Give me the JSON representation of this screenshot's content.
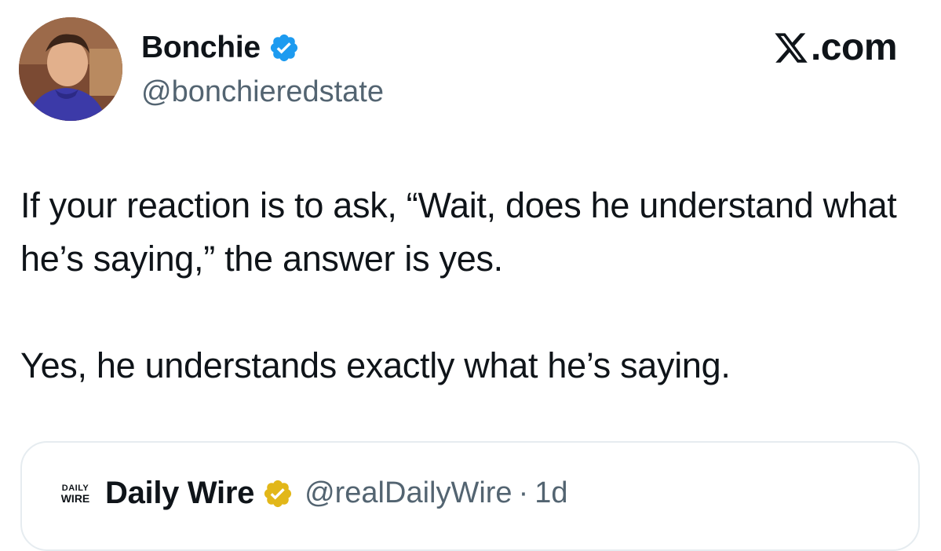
{
  "author": {
    "name": "Bonchie",
    "handle": "@bonchieredstate"
  },
  "site": {
    "label": ".com",
    "logo_icon": "x-logo-icon"
  },
  "tweet": {
    "paragraph1": "If your reaction is to ask, “Wait, does he understand what he’s saying,” the answer is yes.",
    "paragraph2": "Yes, he understands exactly what he’s saying."
  },
  "quote": {
    "logo_text_top": "DAILY",
    "logo_text_bottom": "WIRE",
    "name": "Daily Wire",
    "handle": "@realDailyWire",
    "separator": "·",
    "time": "1d"
  },
  "colors": {
    "verified_blue": "#1d9bf0",
    "verified_gold": "#e2b719",
    "secondary_text": "#536471",
    "border": "#e6ecf0"
  }
}
